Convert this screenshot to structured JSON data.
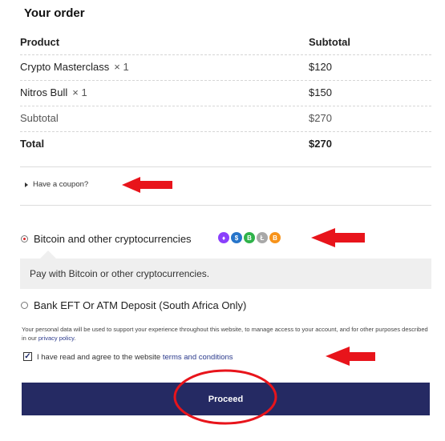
{
  "order": {
    "heading": "Your order",
    "col_product": "Product",
    "col_subtotal": "Subtotal",
    "items": [
      {
        "name": "Crypto Masterclass",
        "qty": "× 1",
        "price": "$120"
      },
      {
        "name": "Nitros Bull",
        "qty": "× 1",
        "price": "$150"
      }
    ],
    "subtotal_label": "Subtotal",
    "subtotal_value": "$270",
    "total_label": "Total",
    "total_value": "$270"
  },
  "coupon": {
    "label": "Have a coupon?"
  },
  "payment": {
    "option_crypto": "Bitcoin and other cryptocurrencies",
    "crypto_description": "Pay with Bitcoin or other cryptocurrencies.",
    "option_bank": "Bank EFT Or ATM Deposit (South Africa Only)",
    "selected": "crypto",
    "coins": [
      {
        "icon": "ethereum-icon",
        "glyph": "♦",
        "color": "#8a3ffc"
      },
      {
        "icon": "usdc-icon",
        "glyph": "$",
        "color": "#2775ca"
      },
      {
        "icon": "bitcoin-cash-icon",
        "glyph": "B",
        "color": "#2fb34a"
      },
      {
        "icon": "litecoin-icon",
        "glyph": "Ł",
        "color": "#a8a8a8"
      },
      {
        "icon": "bitcoin-icon",
        "glyph": "B",
        "color": "#f7931a"
      }
    ]
  },
  "privacy": {
    "text": "Your personal data will be used to support your experience throughout this website, to manage access to your account, and for other purposes described in our ",
    "link": "privacy policy",
    "end": "."
  },
  "terms": {
    "checked": true,
    "check_glyph": "✓",
    "text": "I have read and agree to the website ",
    "link": "terms and conditions"
  },
  "proceed_label": "Proceed",
  "colors": {
    "accent": "#252a63",
    "annotation": "#e8141b",
    "radio_selected": "#d7262a"
  }
}
